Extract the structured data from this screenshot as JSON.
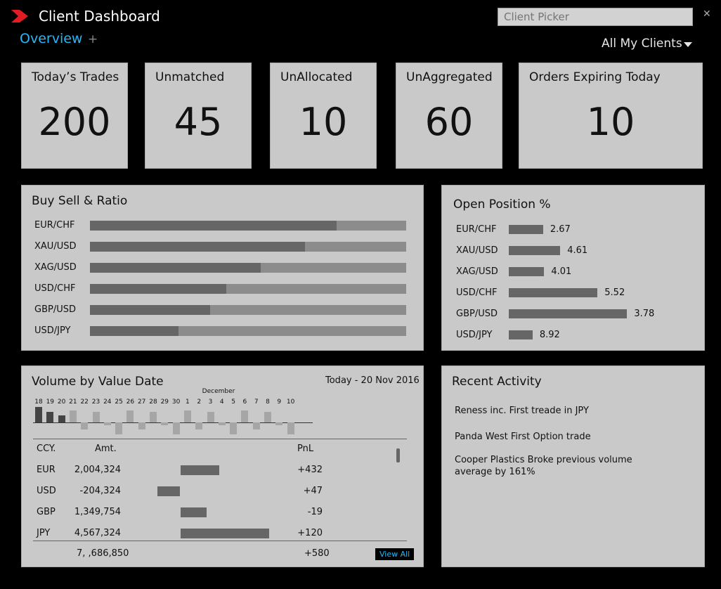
{
  "app": {
    "title": "Client Dashboard",
    "brand_color": "#e31b23"
  },
  "picker": {
    "placeholder": "Client Picker"
  },
  "tabs": {
    "active": "Overview",
    "add": "+"
  },
  "filter": {
    "label": "All My Clients"
  },
  "close_icon": "✕",
  "stats": [
    {
      "title": "Today’s Trades",
      "value": "200"
    },
    {
      "title": "Unmatched",
      "value": "45"
    },
    {
      "title": "UnAllocated",
      "value": "10"
    },
    {
      "title": "UnAggregated",
      "value": "60"
    },
    {
      "title": "Orders Expiring Today",
      "value": "10"
    }
  ],
  "buy_sell": {
    "title": "Buy Sell & Ratio",
    "rows": [
      {
        "label": "EUR/CHF",
        "buy_ratio": 0.78
      },
      {
        "label": "XAU/USD",
        "buy_ratio": 0.68
      },
      {
        "label": "XAG/USD",
        "buy_ratio": 0.54
      },
      {
        "label": "USD/CHF",
        "buy_ratio": 0.43
      },
      {
        "label": "GBP/USD",
        "buy_ratio": 0.38
      },
      {
        "label": "USD/JPY",
        "buy_ratio": 0.28
      }
    ]
  },
  "open_position": {
    "title": "Open Position %",
    "rows": [
      {
        "label": "EUR/CHF",
        "value": "2.67",
        "bar": 2.67
      },
      {
        "label": "XAU/USD",
        "value": "4.61",
        "bar": 4.0
      },
      {
        "label": "XAG/USD",
        "value": "4.01",
        "bar": 2.75
      },
      {
        "label": "USD/CHF",
        "value": "5.52",
        "bar": 6.9
      },
      {
        "label": "GBP/USD",
        "value": "3.78",
        "bar": 9.2
      },
      {
        "label": "USD/JPY",
        "value": "8.92",
        "bar": 1.85
      }
    ]
  },
  "volume": {
    "title": "Volume by Value Date",
    "date": "Today - 20 Nov 2016",
    "month_label": "December",
    "ticks": [
      "18",
      "19",
      "20",
      "21",
      "22",
      "23",
      "24",
      "25",
      "26",
      "27",
      "28",
      "29",
      "30",
      "1",
      "2",
      "3",
      "4",
      "5",
      "6",
      "7",
      "8",
      "9",
      "10"
    ],
    "bars": [
      {
        "v": 22,
        "dark": true
      },
      {
        "v": 15,
        "dark": true
      },
      {
        "v": 10,
        "dark": true
      },
      {
        "v": 17,
        "dark": false
      },
      {
        "v": -10,
        "dark": false
      },
      {
        "v": 15,
        "dark": false
      },
      {
        "v": -4,
        "dark": false
      },
      {
        "v": -17,
        "dark": false
      },
      {
        "v": 17,
        "dark": false
      },
      {
        "v": -10,
        "dark": false
      },
      {
        "v": 15,
        "dark": false
      },
      {
        "v": -4,
        "dark": false
      },
      {
        "v": -17,
        "dark": false
      },
      {
        "v": 17,
        "dark": false
      },
      {
        "v": -10,
        "dark": false
      },
      {
        "v": 15,
        "dark": false
      },
      {
        "v": -4,
        "dark": false
      },
      {
        "v": -17,
        "dark": false
      },
      {
        "v": 17,
        "dark": false
      },
      {
        "v": -10,
        "dark": false
      },
      {
        "v": 15,
        "dark": false
      },
      {
        "v": -4,
        "dark": false
      },
      {
        "v": -17,
        "dark": false
      }
    ],
    "headers": {
      "ccy": "CCY.",
      "amt": "Amt.",
      "pnl": "PnL"
    },
    "rows": [
      {
        "ccy": "EUR",
        "amt": "2,004,324",
        "pnl": "+432",
        "bar": 2004324
      },
      {
        "ccy": "USD",
        "amt": "-204,324",
        "pnl": "+47",
        "bar": -204324
      },
      {
        "ccy": "GBP",
        "amt": "1,349,754",
        "pnl": "-19",
        "bar": 1349754
      },
      {
        "ccy": "JPY",
        "amt": "4,567,324",
        "pnl": "+120",
        "bar": 4567324
      }
    ],
    "total_amt": "7, ,686,850",
    "total_pnl": "+580",
    "view_all": "View All"
  },
  "recent": {
    "title": "Recent Activity",
    "items": [
      "Reness inc. First treade in JPY",
      "Panda West First Option trade",
      "Cooper Plastics Broke previous volume average by 161%"
    ]
  }
}
